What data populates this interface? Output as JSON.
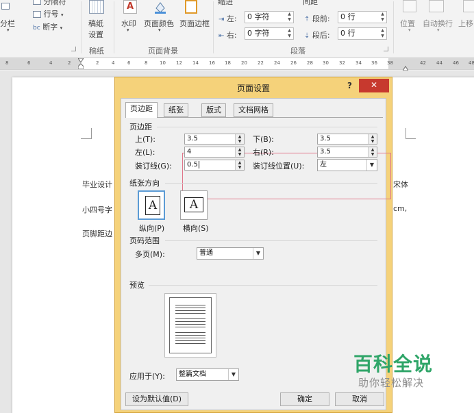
{
  "ribbon": {
    "columns": "分栏",
    "line_numbers": "行号",
    "hyphenation": "断字",
    "breaks_partial": "分隔符",
    "draft_paper_line1": "稿纸",
    "draft_paper_line2": "设置",
    "watermark": "水印",
    "page_color": "页面颜色",
    "page_borders": "页面边框",
    "indent_title_partial": "缩进",
    "spacing_title_partial": "间距",
    "indent_left_label": "左:",
    "indent_left_value": "0 字符",
    "indent_right_label": "右:",
    "indent_right_value": "0 字符",
    "spacing_before_label": "段前:",
    "spacing_before_value": "0 行",
    "spacing_after_label": "段后:",
    "spacing_after_value": "0 行",
    "position": "位置",
    "wrap_text": "自动换行",
    "bring_forward_partial": "上移",
    "group_draft": "稿纸",
    "group_background": "页面背景",
    "group_paragraph": "段落"
  },
  "ruler": {
    "numbers": [
      "8",
      "6",
      "4",
      "2",
      "2",
      "4",
      "6",
      "8",
      "10",
      "12",
      "14",
      "16",
      "18",
      "20",
      "22",
      "24",
      "26",
      "28",
      "30",
      "32",
      "34",
      "36",
      "38",
      "42",
      "44",
      "46",
      "48"
    ]
  },
  "document": {
    "line1_left": "毕业设计",
    "line1_right": "宋体",
    "line2_left": "小四号字",
    "line2_right": "cm,",
    "line3_left": "页脚距边"
  },
  "dialog": {
    "title": "页面设置",
    "help": "?",
    "close": "✕",
    "tabs": [
      "页边距",
      "纸张",
      "版式",
      "文档网格"
    ],
    "margins_section": "页边距",
    "top_label": "上(T):",
    "top_value": "3.5",
    "bottom_label": "下(B):",
    "bottom_value": "3.5",
    "left_label": "左(L):",
    "left_value": "4",
    "right_label": "右(R):",
    "right_value": "3.5",
    "gutter_label": "装订线(G):",
    "gutter_value": "0.5",
    "gutter_pos_label": "装订线位置(U):",
    "gutter_pos_value": "左",
    "orientation_section": "纸张方向",
    "portrait_label": "纵向(P)",
    "landscape_label": "横向(S)",
    "orient_glyph": "A",
    "pages_section": "页码范围",
    "multiple_pages_label": "多页(M):",
    "multiple_pages_value": "普通",
    "preview_section": "预览",
    "apply_to_label": "应用于(Y):",
    "apply_to_value": "整篇文档",
    "set_default": "设为默认值(D)",
    "ok": "确定",
    "cancel": "取消"
  },
  "watermark": {
    "title": "百科全说",
    "subtitle": "助你轻松解决"
  },
  "colors": {
    "dialog_frame": "#f5d27a",
    "close_button": "#c7392e",
    "highlight_border": "#e0768a",
    "watermark_green": "#2fa568"
  }
}
